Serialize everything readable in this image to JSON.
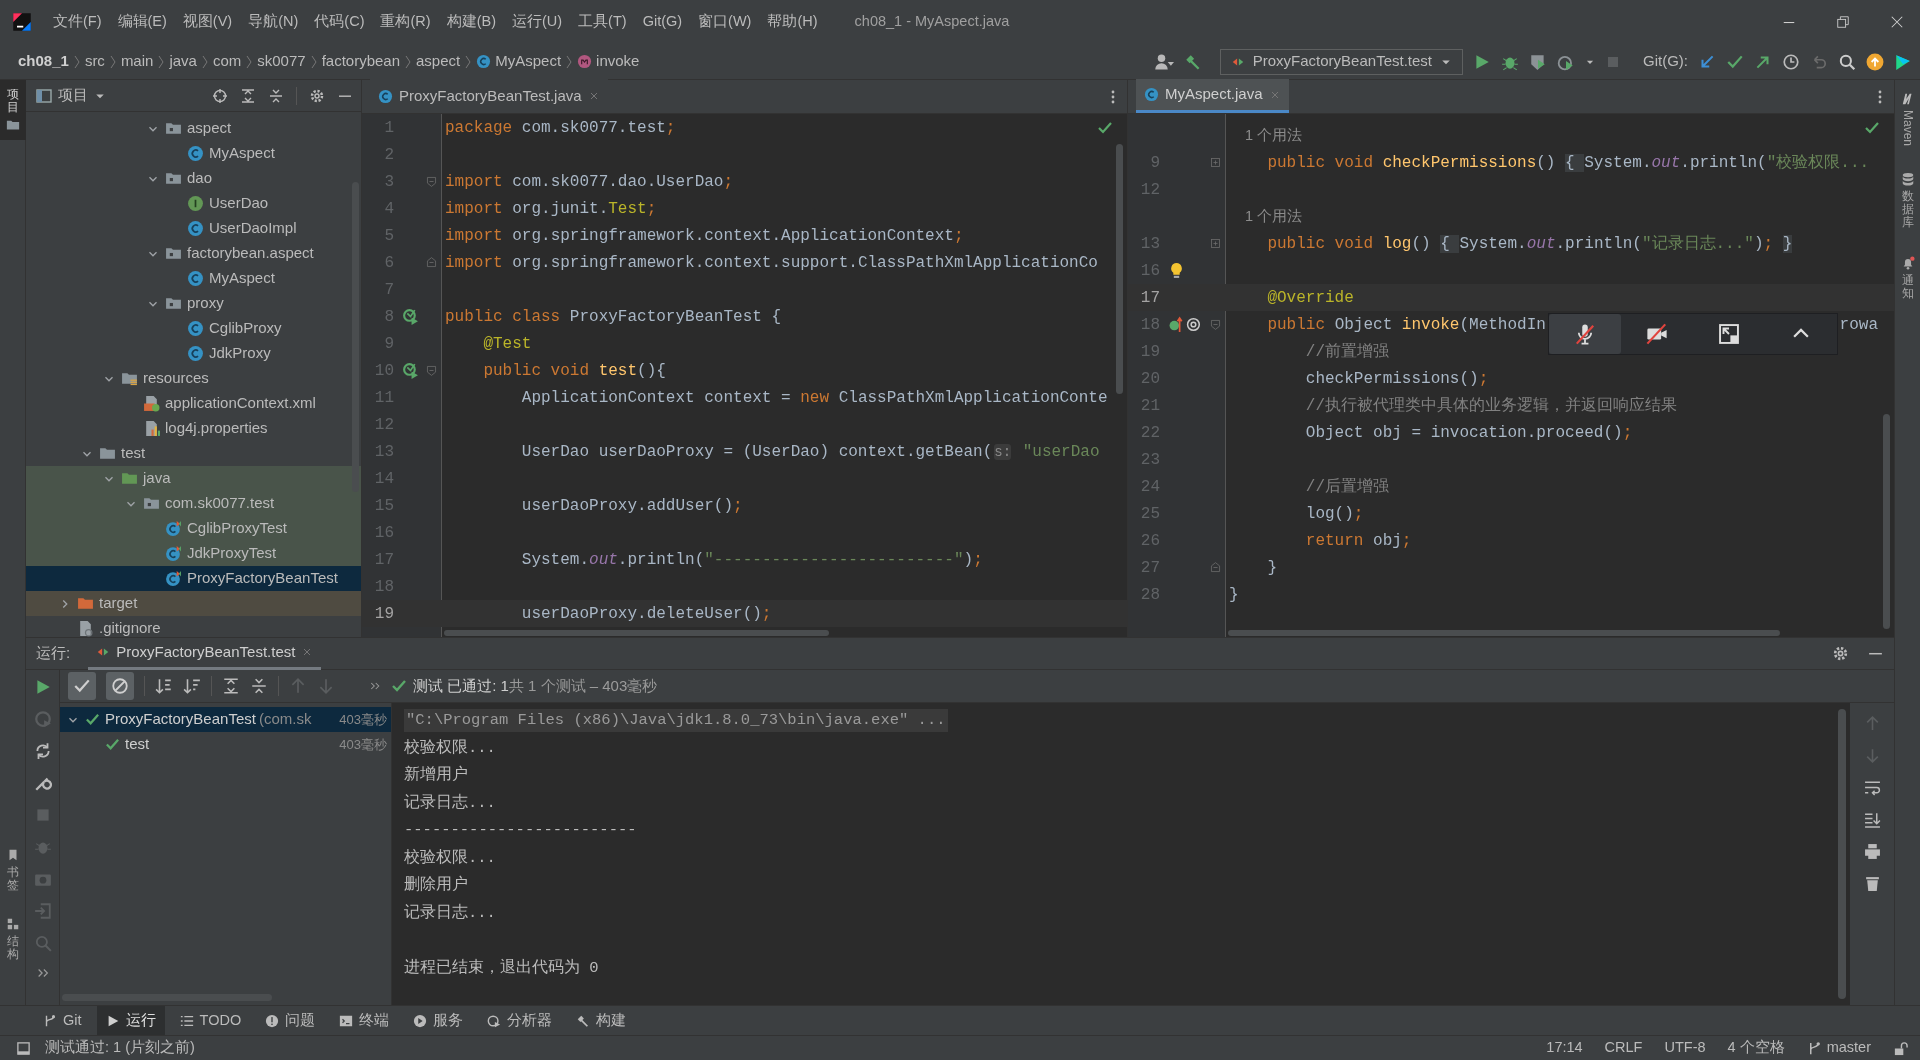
{
  "menu_bar": {
    "items": [
      "文件(F)",
      "编辑(E)",
      "视图(V)",
      "导航(N)",
      "代码(C)",
      "重构(R)",
      "构建(B)",
      "运行(U)",
      "工具(T)",
      "Git(G)",
      "窗口(W)",
      "帮助(H)"
    ],
    "title": "ch08_1 - MyAspect.java"
  },
  "breadcrumb": [
    {
      "text": "ch08_1",
      "kind": "project"
    },
    {
      "text": "src",
      "kind": "dir"
    },
    {
      "text": "main",
      "kind": "dir"
    },
    {
      "text": "java",
      "kind": "dir"
    },
    {
      "text": "com",
      "kind": "dir"
    },
    {
      "text": "sk0077",
      "kind": "dir"
    },
    {
      "text": "factorybean",
      "kind": "dir"
    },
    {
      "text": "aspect",
      "kind": "dir"
    },
    {
      "text": "MyAspect",
      "kind": "class"
    },
    {
      "text": "invoke",
      "kind": "method"
    }
  ],
  "toolbar": {
    "run_config": "ProxyFactoryBeanTest.test",
    "git_label": "Git(G):"
  },
  "left_strip": {
    "top": [
      {
        "label": "项目",
        "kind": "project",
        "selected": true
      }
    ],
    "bottom": [
      {
        "label": "书签",
        "kind": "bookmarks",
        "selected": false
      },
      {
        "label": "结构",
        "kind": "structure",
        "selected": false
      }
    ]
  },
  "right_strip": [
    {
      "label": "Maven",
      "kind": "maven",
      "selected": false
    },
    {
      "label": "数据库",
      "kind": "database",
      "selected": false
    },
    {
      "label": "通知",
      "kind": "notifications",
      "selected": false
    }
  ],
  "project": {
    "title": "项目",
    "tree": [
      {
        "children": [
          {
            "children": [
              {
                "children": [
                  {
                    "children": [
                      {
                        "label": "aspect",
                        "kind": "package",
                        "expanded": true,
                        "selected": false,
                        "children": [
                          {
                            "label": "MyAspect",
                            "kind": "class",
                            "selected": false
                          }
                        ]
                      },
                      {
                        "label": "dao",
                        "kind": "package",
                        "expanded": true,
                        "selected": false,
                        "children": [
                          {
                            "label": "UserDao",
                            "kind": "interface",
                            "selected": false
                          },
                          {
                            "label": "UserDaoImpl",
                            "kind": "class",
                            "selected": false
                          }
                        ]
                      },
                      {
                        "label": "factorybean.aspect",
                        "kind": "package",
                        "expanded": true,
                        "selected": false,
                        "children": [
                          {
                            "label": "MyAspect",
                            "kind": "class",
                            "selected": false
                          }
                        ]
                      },
                      {
                        "label": "proxy",
                        "kind": "package",
                        "expanded": true,
                        "selected": false,
                        "children": [
                          {
                            "label": "CglibProxy",
                            "kind": "class",
                            "selected": false
                          },
                          {
                            "label": "JdkProxy",
                            "kind": "class",
                            "selected": false
                          }
                        ]
                      }
                    ]
                  }
                ]
              },
              {
                "label": "resources",
                "kind": "resources",
                "expanded": true,
                "selected": false,
                "children": [
                  {
                    "label": "applicationContext.xml",
                    "kind": "xml",
                    "selected": false
                  },
                  {
                    "label": "log4j.properties",
                    "kind": "properties",
                    "selected": false
                  }
                ]
              }
            ]
          },
          {
            "label": "test",
            "kind": "folder",
            "expanded": true,
            "selected": false,
            "children": [
              {
                "label": "java",
                "kind": "test_source",
                "expanded": true,
                "selected": false,
                "color": "#49544a",
                "children": [
                  {
                    "label": "com.sk0077.test",
                    "kind": "package",
                    "expanded": true,
                    "selected": false,
                    "color": "#49544a",
                    "children": [
                      {
                        "label": "CglibProxyTest",
                        "kind": "test_class",
                        "selected": false,
                        "color": "#49544a"
                      },
                      {
                        "label": "JdkProxyTest",
                        "kind": "test_class",
                        "selected": false,
                        "color": "#49544a"
                      },
                      {
                        "label": "ProxyFactoryBeanTest",
                        "kind": "test_class",
                        "selected": true
                      }
                    ]
                  }
                ]
              }
            ]
          }
        ]
      },
      {
        "label": "target",
        "kind": "excluded",
        "expanded": false,
        "selected": false,
        "color": "#4f4b41"
      },
      {
        "label": ".gitignore",
        "kind": "file",
        "selected": false
      }
    ]
  },
  "editors": [
    {
      "tab": {
        "label": "ProxyFactoryBeanTest.java",
        "selected": false
      },
      "lines": [
        {
          "n": "1",
          "current": false,
          "tokens": [
            {
              "kind": "keyword",
              "text": "package "
            },
            {
              "kind": "plain",
              "text": "com.sk0077.test"
            },
            {
              "kind": "keyword",
              "text": ";"
            }
          ]
        },
        {
          "n": "2",
          "current": false
        },
        {
          "n": "3",
          "current": false,
          "fold": {
            "kind": "start"
          },
          "tokens": [
            {
              "kind": "keyword",
              "text": "import "
            },
            {
              "kind": "plain",
              "text": "com.sk0077.dao.UserDao"
            },
            {
              "kind": "keyword",
              "text": ";"
            }
          ]
        },
        {
          "n": "4",
          "current": false,
          "tokens": [
            {
              "kind": "keyword",
              "text": "import "
            },
            {
              "kind": "plain",
              "text": "org.junit."
            },
            {
              "kind": "annotation",
              "text": "Test"
            },
            {
              "kind": "keyword",
              "text": ";"
            }
          ]
        },
        {
          "n": "5",
          "current": false,
          "tokens": [
            {
              "kind": "keyword",
              "text": "import "
            },
            {
              "kind": "plain",
              "text": "org.springframework.context.ApplicationContext"
            },
            {
              "kind": "keyword",
              "text": ";"
            }
          ]
        },
        {
          "n": "6",
          "current": false,
          "fold": {
            "kind": "end"
          },
          "tokens": [
            {
              "kind": "keyword",
              "text": "import "
            },
            {
              "kind": "plain",
              "text": "org.springframework.context.support.ClassPathXmlApplicationCo"
            }
          ]
        },
        {
          "n": "7",
          "current": false
        },
        {
          "n": "8",
          "current": false,
          "marker": {
            "kind": "run"
          },
          "tokens": [
            {
              "kind": "keyword",
              "text": "public class "
            },
            {
              "kind": "plain",
              "text": "ProxyFactoryBeanTest {"
            }
          ]
        },
        {
          "n": "9",
          "current": false,
          "tokens": [
            {
              "kind": "annotation",
              "text": "    @Test"
            }
          ]
        },
        {
          "n": "10",
          "current": false,
          "marker": {
            "kind": "run"
          },
          "fold": {
            "kind": "start"
          },
          "tokens": [
            {
              "kind": "keyword",
              "text": "    public void "
            },
            {
              "kind": "function",
              "text": "test"
            },
            {
              "kind": "plain",
              "text": "(){"
            }
          ]
        },
        {
          "n": "11",
          "current": false,
          "tokens": [
            {
              "kind": "plain",
              "text": "        ApplicationContext context = "
            },
            {
              "kind": "keyword",
              "text": "new "
            },
            {
              "kind": "plain",
              "text": "ClassPathXmlApplicationConte"
            }
          ]
        },
        {
          "n": "12",
          "current": false
        },
        {
          "n": "13",
          "current": false,
          "tokens": [
            {
              "kind": "plain",
              "text": "        UserDao userDaoProxy = (UserDao) context.getBean("
            },
            {
              "kind": "param_hint",
              "text": "s:"
            },
            {
              "kind": "string",
              "text": " \"userDao"
            }
          ]
        },
        {
          "n": "14",
          "current": false
        },
        {
          "n": "15",
          "current": false,
          "tokens": [
            {
              "kind": "plain",
              "text": "        userDaoProxy.addUser()"
            },
            {
              "kind": "keyword",
              "text": ";"
            }
          ]
        },
        {
          "n": "16",
          "current": false
        },
        {
          "n": "17",
          "current": false,
          "tokens": [
            {
              "kind": "plain",
              "text": "        System."
            },
            {
              "kind": "field",
              "text": "out"
            },
            {
              "kind": "plain",
              "text": ".println("
            },
            {
              "kind": "string",
              "text": "\"-------------------------\""
            },
            {
              "kind": "plain",
              "text": ")"
            },
            {
              "kind": "keyword",
              "text": ";"
            }
          ]
        },
        {
          "n": "18",
          "current": false
        },
        {
          "n": "19",
          "current": true,
          "tokens": [
            {
              "kind": "plain",
              "text": "        userDaoProxy.deleteUser()"
            },
            {
              "kind": "keyword",
              "text": ";"
            }
          ]
        }
      ]
    },
    {
      "tab": {
        "label": "MyAspect.java",
        "selected": true
      },
      "lines": [
        {
          "current": false,
          "tokens": [
            {
              "kind": "usage",
              "text": "    1 个用法"
            }
          ]
        },
        {
          "n": "9",
          "current": false,
          "fold": {
            "kind": "collapsed"
          },
          "tokens": [
            {
              "kind": "keyword",
              "text": "    public void "
            },
            {
              "kind": "function",
              "text": "checkPermissions"
            },
            {
              "kind": "plain",
              "text": "() "
            },
            {
              "kind": "folded",
              "text": "{ "
            },
            {
              "kind": "plain",
              "text": "System."
            },
            {
              "kind": "field",
              "text": "out"
            },
            {
              "kind": "plain",
              "text": ".println("
            },
            {
              "kind": "string",
              "text": "\"校验权限..."
            }
          ]
        },
        {
          "n": "12",
          "current": false
        },
        {
          "current": false,
          "tokens": [
            {
              "kind": "usage",
              "text": "    1 个用法"
            }
          ]
        },
        {
          "n": "13",
          "current": false,
          "fold": {
            "kind": "collapsed"
          },
          "tokens": [
            {
              "kind": "keyword",
              "text": "    public void "
            },
            {
              "kind": "function",
              "text": "log"
            },
            {
              "kind": "plain",
              "text": "() "
            },
            {
              "kind": "folded",
              "text": "{ "
            },
            {
              "kind": "plain",
              "text": "System."
            },
            {
              "kind": "field",
              "text": "out"
            },
            {
              "kind": "plain",
              "text": ".println("
            },
            {
              "kind": "string",
              "text": "\"记录日志...\""
            },
            {
              "kind": "plain",
              "text": ")"
            },
            {
              "kind": "keyword",
              "text": "; "
            },
            {
              "kind": "folded",
              "text": "}"
            }
          ]
        },
        {
          "n": "16",
          "current": false,
          "marker": {
            "kind": "bulb"
          }
        },
        {
          "n": "17",
          "current": true,
          "tokens": [
            {
              "kind": "annotation",
              "text": "    @Override"
            }
          ]
        },
        {
          "n": "18",
          "current": false,
          "marker": {
            "kind": "implements"
          },
          "fold": {
            "kind": "start"
          },
          "tokens": [
            {
              "kind": "keyword",
              "text": "    public "
            },
            {
              "kind": "plain",
              "text": "Object "
            },
            {
              "kind": "function",
              "text": "invoke"
            },
            {
              "kind": "plain",
              "text": "(MethodIn"
            }
          ],
          "tail": "rowa"
        },
        {
          "n": "19",
          "current": false,
          "tokens": [
            {
              "kind": "comment",
              "text": "        //前置增强"
            }
          ]
        },
        {
          "n": "20",
          "current": false,
          "tokens": [
            {
              "kind": "plain",
              "text": "        checkPermissions()"
            },
            {
              "kind": "keyword",
              "text": ";"
            }
          ]
        },
        {
          "n": "21",
          "current": false,
          "tokens": [
            {
              "kind": "comment",
              "text": "        //执行被代理类中具体的业务逻辑，并返回响应结果"
            }
          ]
        },
        {
          "n": "22",
          "current": false,
          "tokens": [
            {
              "kind": "plain",
              "text": "        Object obj = invocation.proceed()"
            },
            {
              "kind": "keyword",
              "text": ";"
            }
          ]
        },
        {
          "n": "23",
          "current": false
        },
        {
          "n": "24",
          "current": false,
          "tokens": [
            {
              "kind": "comment",
              "text": "        //后置增强"
            }
          ]
        },
        {
          "n": "25",
          "current": false,
          "tokens": [
            {
              "kind": "plain",
              "text": "        log()"
            },
            {
              "kind": "keyword",
              "text": ";"
            }
          ]
        },
        {
          "n": "26",
          "current": false,
          "tokens": [
            {
              "kind": "keyword",
              "text": "        return "
            },
            {
              "kind": "plain",
              "text": "obj"
            },
            {
              "kind": "keyword",
              "text": ";"
            }
          ]
        },
        {
          "n": "27",
          "current": false,
          "fold": {
            "kind": "end"
          },
          "tokens": [
            {
              "kind": "plain",
              "text": "    }"
            }
          ]
        },
        {
          "n": "28",
          "current": false,
          "tokens": [
            {
              "kind": "plain",
              "text": "}"
            }
          ]
        }
      ]
    }
  ],
  "run": {
    "label": "运行:",
    "tab": "ProxyFactoryBeanTest.test",
    "filters": [
      {
        "kind": "passed",
        "on": true
      },
      {
        "kind": "ignored",
        "on": true
      }
    ],
    "status_label": "测试 已通过: 1",
    "status_detail": "共 1 个测试 – 403毫秒",
    "tests": [
      {
        "label": "ProxyFactoryBeanTest",
        "detail": "(com.sk",
        "time": "403毫秒",
        "passed": true,
        "expanded": true,
        "selected": true,
        "children": [
          {
            "label": "test",
            "time": "403毫秒",
            "passed": true,
            "selected": false
          }
        ]
      }
    ],
    "console": [
      {
        "kind": "command",
        "text": "\"C:\\Program Files (x86)\\Java\\jdk1.8.0_73\\bin\\java.exe\" ..."
      },
      {
        "kind": "output",
        "text": "校验权限..."
      },
      {
        "kind": "output",
        "text": "新增用户"
      },
      {
        "kind": "output",
        "text": "记录日志..."
      },
      {
        "kind": "output",
        "text": "-------------------------"
      },
      {
        "kind": "output",
        "text": "校验权限..."
      },
      {
        "kind": "output",
        "text": "删除用户"
      },
      {
        "kind": "output",
        "text": "记录日志..."
      },
      {
        "kind": "output",
        "text": "进程已结束，退出代码为 0",
        "gap_before": true
      }
    ]
  },
  "tool_tabs": [
    {
      "label": "Git",
      "kind": "git",
      "selected": false
    },
    {
      "label": "运行",
      "kind": "run",
      "selected": true
    },
    {
      "label": "TODO",
      "kind": "todo",
      "selected": false
    },
    {
      "label": "问题",
      "kind": "problems",
      "selected": false
    },
    {
      "label": "终端",
      "kind": "terminal",
      "selected": false
    },
    {
      "label": "服务",
      "kind": "services",
      "selected": false
    },
    {
      "label": "分析器",
      "kind": "profiler",
      "selected": false
    },
    {
      "label": "构建",
      "kind": "build",
      "selected": false
    }
  ],
  "status_bar": {
    "message": "测试通过: 1 (片刻之前)",
    "items": [
      "17:14",
      "CRLF",
      "UTF-8",
      "4 个空格"
    ],
    "branch": "master"
  }
}
